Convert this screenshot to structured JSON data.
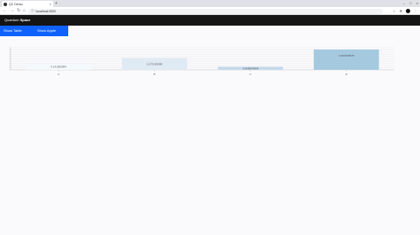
{
  "browser": {
    "tab_title": "QC Demo",
    "url": "localhost:3000"
  },
  "app": {
    "brand_prefix": "Quantum",
    "brand_suffix": "Space",
    "show_table_label": "Show Table",
    "show_apple_label": "Show Apple"
  },
  "chart_data": {
    "type": "bar",
    "categories": [
      "A",
      "B",
      "C",
      "D"
    ],
    "values": [
      0.14,
      0.27,
      0.07,
      0.46
    ],
    "bar_labels": [
      "0.141592654",
      "0.272165568",
      "0.058543568",
      "0.462345678"
    ],
    "bar_colors": [
      "#f4f9fd",
      "#e0eaf4",
      "#c5d9ec",
      "#a5cae0"
    ],
    "ylim": [
      0,
      0.5
    ],
    "grid": true
  }
}
